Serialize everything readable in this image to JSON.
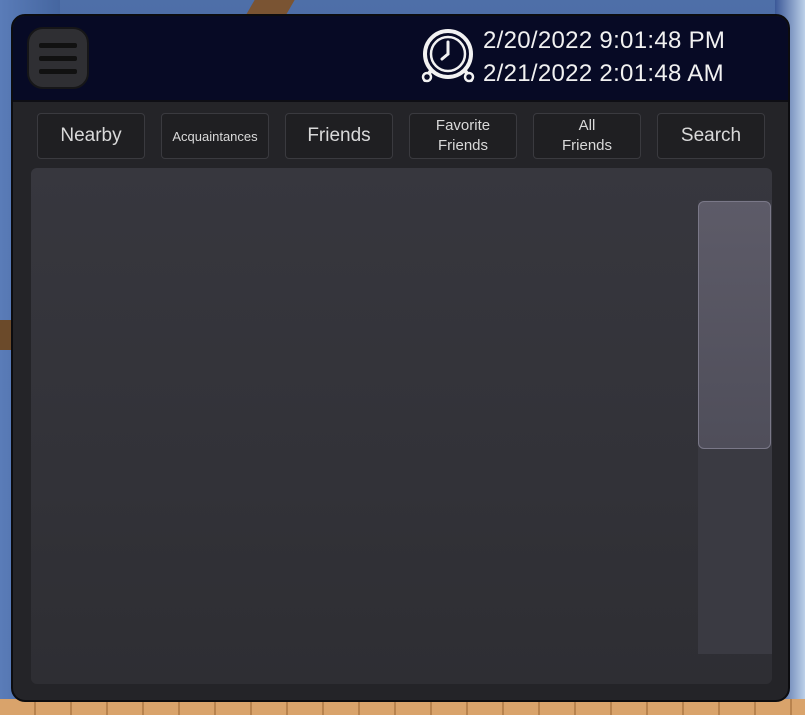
{
  "header": {
    "date_line_1": "2/20/2022 9:01:48 PM",
    "date_line_2": "2/21/2022 2:01:48 AM",
    "clock_icon": "alarm-clock-icon",
    "menu_icon": "hamburger-menu-icon"
  },
  "tabs": [
    {
      "label": "Nearby"
    },
    {
      "label": "Acquaintances"
    },
    {
      "label": "Friends"
    },
    {
      "label": "Favorite\nFriends"
    },
    {
      "label": "All\nFriends"
    },
    {
      "label": "Search"
    }
  ],
  "colors": {
    "header_bg": "#070a25",
    "panel_bg": "#242428",
    "content_bg": "#36363c",
    "scroll_thumb": "#55545f"
  }
}
